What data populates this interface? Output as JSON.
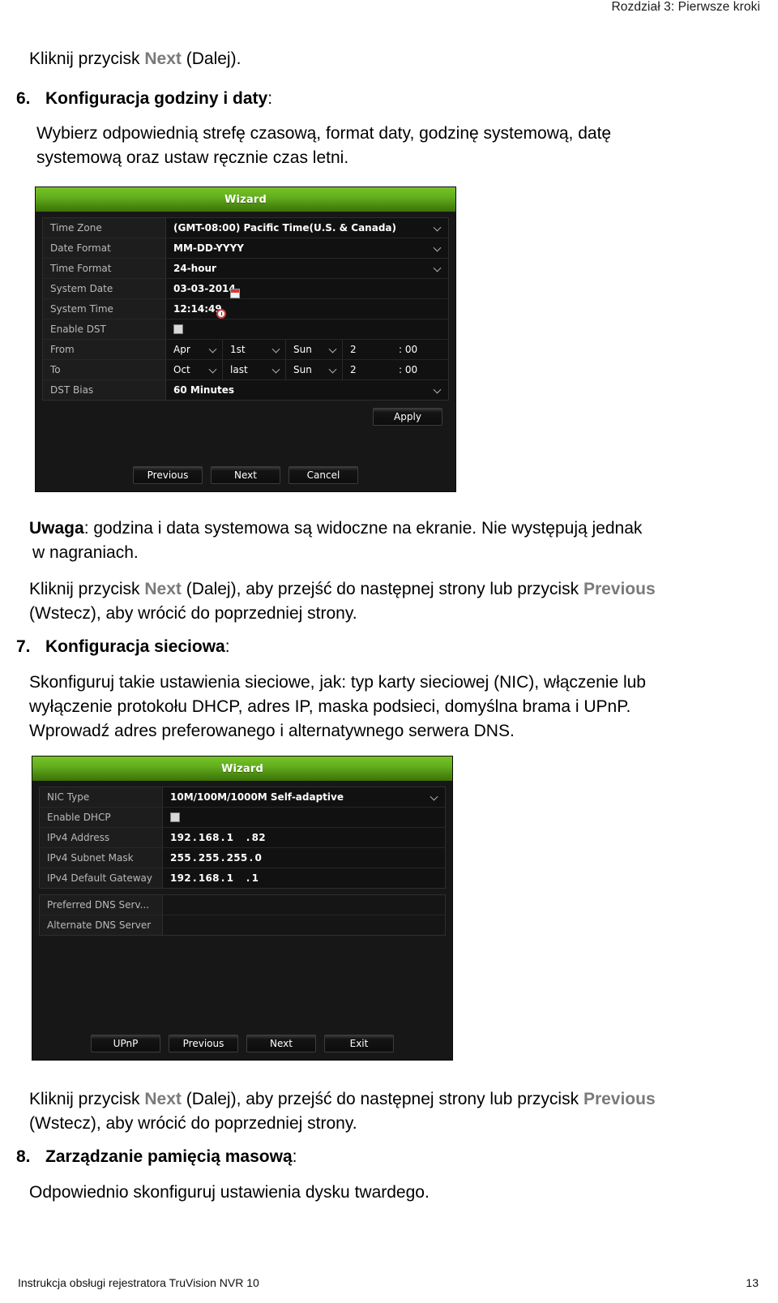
{
  "header": {
    "chapter": "Rozdział 3: Pierwsze kroki"
  },
  "content": {
    "intro_line": {
      "pre": "Kliknij przycisk ",
      "en": "Next",
      "post": " (Dalej)."
    },
    "step6": {
      "number": "6.",
      "heading": "Konfiguracja godziny i daty",
      "heading_tail": ":",
      "body_line1": "Wybierz odpowiednią strefę czasową, format daty, godzinę systemową, datę",
      "body_line2": "systemową oraz ustaw ręcznie czas letni."
    },
    "note": {
      "label": "Uwaga",
      "line1_rest": ": godzina i data systemowa są widoczne na ekranie. Nie występują jednak",
      "line2": "w nagraniach."
    },
    "nav_note_1": {
      "pre": "Kliknij przycisk ",
      "en1": "Next",
      "mid": " (Dalej), aby przejść do następnej strony lub przycisk ",
      "en2": "Previous",
      "line2": "(Wstecz), aby wrócić do poprzedniej strony."
    },
    "step7": {
      "number": "7.",
      "heading": "Konfiguracja sieciowa",
      "heading_tail": ":",
      "body_line1": "Skonfiguruj takie ustawienia sieciowe, jak: typ karty sieciowej (NIC), włączenie lub",
      "body_line2": "wyłączenie protokołu DHCP, adres IP, maska podsieci, domyślna brama i UPnP.",
      "body_line3": "Wprowadź adres preferowanego i alternatywnego serwera DNS."
    },
    "nav_note_2": {
      "pre": "Kliknij przycisk ",
      "en1": "Next",
      "mid": " (Dalej), aby przejść do następnej strony lub przycisk ",
      "en2": "Previous",
      "line2": "(Wstecz), aby wrócić do poprzedniej strony."
    },
    "step8": {
      "number": "8.",
      "heading": "Zarządzanie pamięcią masową",
      "heading_tail": ":",
      "body_line1": "Odpowiednio skonfiguruj ustawienia dysku twardego."
    }
  },
  "figure_time": {
    "title": "Wizard",
    "rows": [
      {
        "label": "Time Zone",
        "value": "(GMT-08:00) Pacific Time(U.S. & Canada)",
        "control": "dropdown"
      },
      {
        "label": "Date Format",
        "value": "MM-DD-YYYY",
        "control": "dropdown"
      },
      {
        "label": "Time Format",
        "value": "24-hour",
        "control": "dropdown"
      },
      {
        "label": "System Date",
        "value": "03-03-2014",
        "control": "calendar"
      },
      {
        "label": "System Time",
        "value": "12:14:49",
        "control": "clock"
      },
      {
        "label": "Enable DST",
        "value": "",
        "control": "checkbox"
      }
    ],
    "dst_from": {
      "label": "From",
      "month": "Apr",
      "ordinal": "1st",
      "weekday": "Sun",
      "hour": "2",
      "minute": ": 00"
    },
    "dst_to": {
      "label": "To",
      "month": "Oct",
      "ordinal": "last",
      "weekday": "Sun",
      "hour": "2",
      "minute": ": 00"
    },
    "dst_bias": {
      "label": "DST Bias",
      "value": "60 Minutes"
    },
    "apply_label": "Apply",
    "buttons": [
      "Previous",
      "Next",
      "Cancel"
    ]
  },
  "figure_network": {
    "title": "Wizard",
    "rows": [
      {
        "label": "NIC Type",
        "value": "10M/100M/1000M Self-adaptive",
        "control": "dropdown"
      },
      {
        "label": "Enable DHCP",
        "value": "",
        "control": "checkbox"
      }
    ],
    "ipv4_address": {
      "label": "IPv4 Address",
      "octets": [
        "192",
        "168",
        "1",
        "82"
      ]
    },
    "ipv4_subnet": {
      "label": "IPv4 Subnet Mask",
      "octets": [
        "255",
        "255",
        "255",
        "0"
      ]
    },
    "ipv4_gateway": {
      "label": "IPv4 Default Gateway",
      "octets": [
        "192",
        "168",
        "1",
        "1"
      ]
    },
    "dns_rows": [
      {
        "label": "Preferred DNS Serv...",
        "value": ""
      },
      {
        "label": "Alternate DNS Server",
        "value": ""
      }
    ],
    "buttons": [
      "UPnP",
      "Previous",
      "Next",
      "Exit"
    ]
  },
  "footer": {
    "left": "Instrukcja obsługi rejestratora TruVision NVR 10",
    "page": "13"
  },
  "colors": {
    "accent_green": "#76c425",
    "en_term_gray": "#7a7a7a",
    "dialog_bg": "#171717"
  }
}
